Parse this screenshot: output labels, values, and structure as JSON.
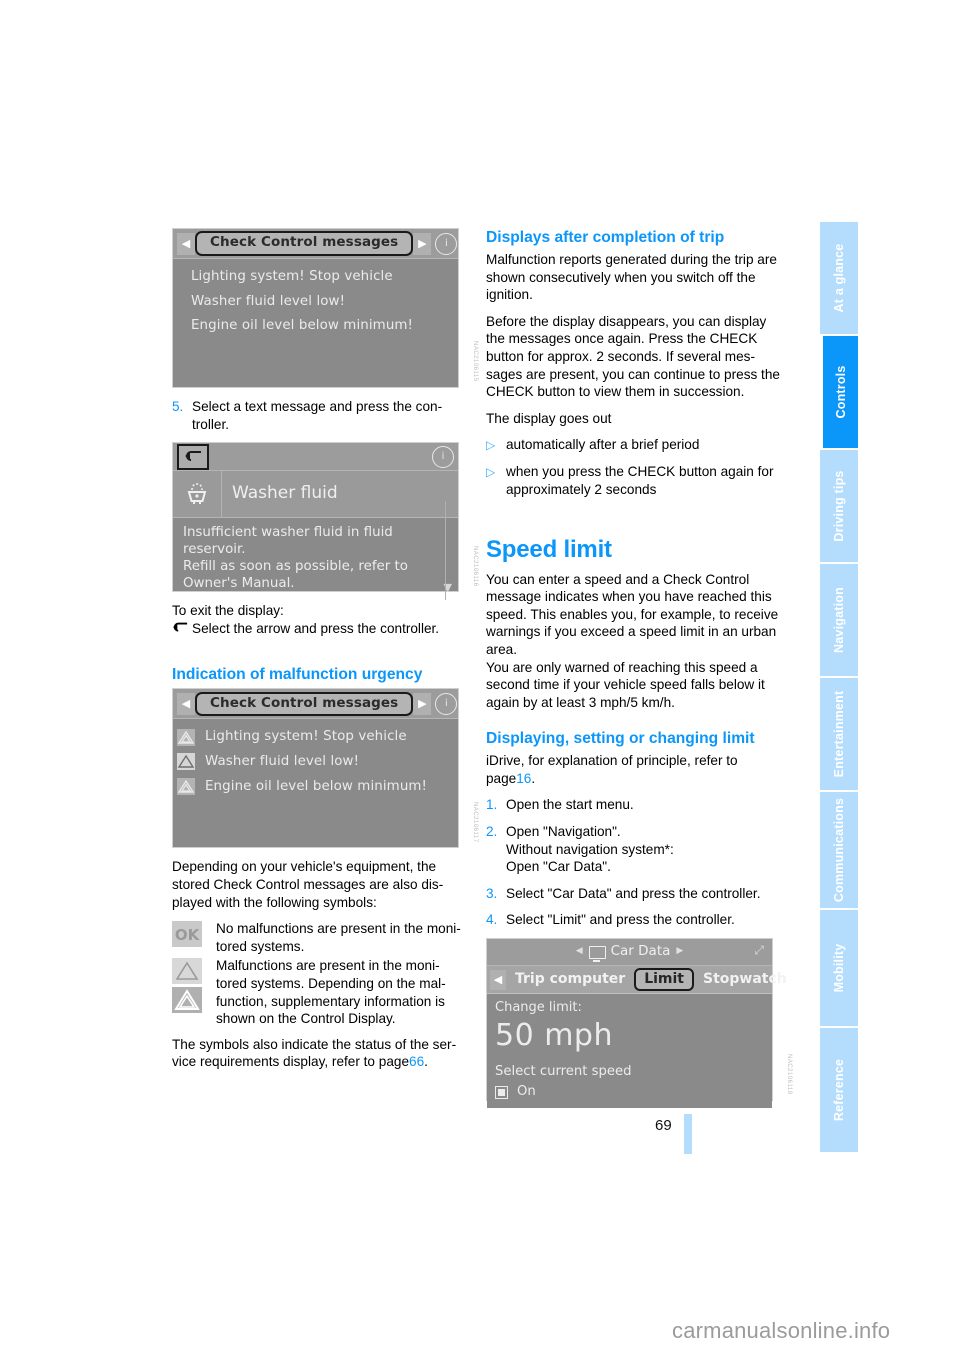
{
  "page": {
    "number": "69",
    "watermark": "carmanualsonline.info"
  },
  "tabs": [
    {
      "label": "At a glance",
      "active": false
    },
    {
      "label": "Controls",
      "active": true
    },
    {
      "label": "Driving tips",
      "active": false
    },
    {
      "label": "Navigation",
      "active": false
    },
    {
      "label": "Entertainment",
      "active": false
    },
    {
      "label": "Communications",
      "active": false
    },
    {
      "label": "Mobility",
      "active": false
    },
    {
      "label": "Reference",
      "active": false
    }
  ],
  "left": {
    "screen_cc": {
      "title": "Check Control messages",
      "messages": [
        "Lighting system! Stop vehicle",
        "Washer fluid level low!",
        "Engine oil level below minimum!"
      ],
      "left_arrow": "◀",
      "right_arrow": "▶",
      "info_icon": "info-icon"
    },
    "step5": {
      "num": "5.",
      "text": "Select a text message and press the con-troller."
    },
    "screen_washer": {
      "back_glyph": "⬑",
      "title": "Washer fluid",
      "body": "Insufficient washer fluid in fluid reservoir.\nRefill as soon as possible, refer to Owner's Manual.",
      "scroll_glyph": "▼"
    },
    "exit_heading": "To exit the display:",
    "exit_text": "Select the arrow and press the controller.",
    "urgency_heading": "Indication of malfunction urgency",
    "screen_cc2": {
      "title": "Check Control messages",
      "messages": [
        "Lighting system! Stop vehicle",
        "Washer fluid level low!",
        "Engine oil level below minimum!"
      ]
    },
    "depending_text": "Depending on your vehicle's equipment, the stored Check Control messages are also dis-played with the following symbols:",
    "symbols": [
      {
        "icon": "ok-symbol",
        "text": "No malfunctions are present in the moni-tored systems."
      },
      {
        "icon": "warning-triangle-light",
        "text": "Malfunctions are present in the moni-tored systems. Depending on the mal-function, supplementary information is shown on the Control Display."
      }
    ],
    "service_text_pre": "The symbols also indicate the status of the ser-vice requirements display, refer to page",
    "service_page": "66",
    "service_text_post": "."
  },
  "right": {
    "trip_heading": "Displays after completion of trip",
    "trip_p1": "Malfunction reports generated during the trip are shown consecutively when you switch off the ignition.",
    "trip_p2": "Before the display disappears, you can display the messages once again. Press the CHECK button for approx. 2 seconds. If several mes-sages are present, you can continue to press the CHECK button to view them in succession.",
    "trip_p3": "The display goes out",
    "bullets": [
      "automatically after a brief period",
      "when you press the CHECK button again for approximately 2 seconds"
    ],
    "bullet_glyph": "▷",
    "speed_heading": "Speed limit",
    "speed_p1": "You can enter a speed and a Check Control message indicates when you have reached this speed. This enables you, for example, to receive warnings if you exceed a speed limit in an urban area.",
    "speed_p2": "You are only warned of reaching this speed a second time if your vehicle speed falls below it again by at least 3 mph/5 km/h.",
    "setting_heading": "Displaying, setting or changing limit",
    "idrive_pre": "iDrive, for explanation of principle, refer to page",
    "idrive_page": "16",
    "idrive_post": ".",
    "steps": [
      {
        "num": "1.",
        "text": "Open the start menu."
      },
      {
        "num": "2.",
        "text": "Open \"Navigation\".\nWithout navigation system*:\nOpen \"Car Data\"."
      },
      {
        "num": "3.",
        "text": "Select \"Car Data\" and press the controller."
      },
      {
        "num": "4.",
        "text": "Select \"Limit\" and press the controller."
      }
    ],
    "screen_cardata": {
      "title": "Car Data",
      "tabs": [
        "Trip computer",
        "Limit",
        "Stopwatch"
      ],
      "selected_tab": "Limit",
      "change_label": "Change limit:",
      "value": "50 mph",
      "select_label": "Select current speed",
      "checkbox_label": "On",
      "left_caret": "◀",
      "right_caret": "▶"
    }
  },
  "colors": {
    "accent": "#0b97fa",
    "tab_inactive": "#b3dcfd",
    "screen_bg": "#8a8a8a"
  }
}
